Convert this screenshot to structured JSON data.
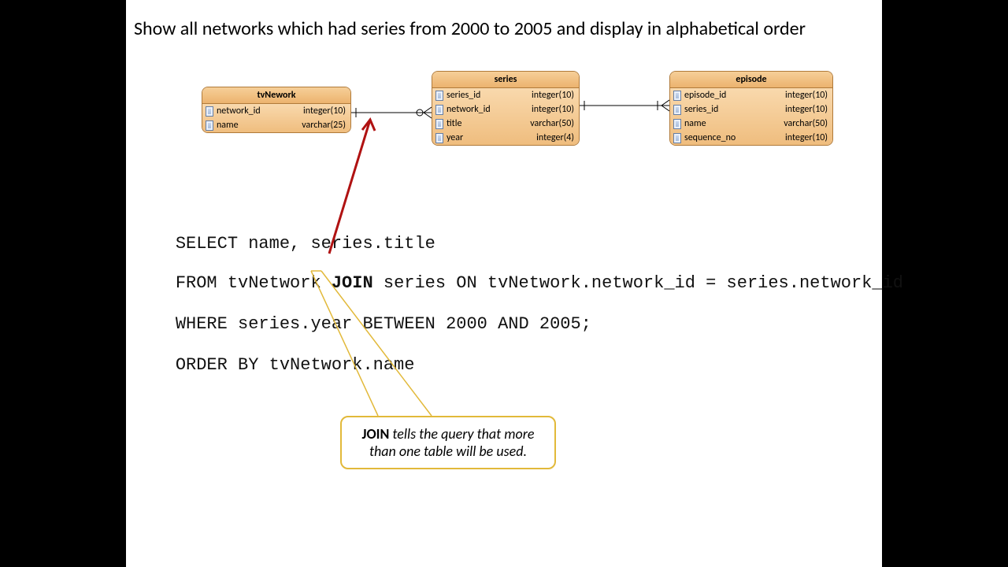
{
  "prompt": "Show all networks which had series from 2000 to 2005 and display in alphabetical order",
  "tables": {
    "tvNework": {
      "title": "tvNework",
      "columns": [
        {
          "name": "network_id",
          "type": "integer(10)"
        },
        {
          "name": "name",
          "type": "varchar(25)"
        }
      ]
    },
    "series": {
      "title": "series",
      "columns": [
        {
          "name": "series_id",
          "type": "integer(10)"
        },
        {
          "name": "network_id",
          "type": "integer(10)"
        },
        {
          "name": "title",
          "type": "varchar(50)"
        },
        {
          "name": "year",
          "type": "integer(4)"
        }
      ]
    },
    "episode": {
      "title": "episode",
      "columns": [
        {
          "name": "episode_id",
          "type": "integer(10)"
        },
        {
          "name": "series_id",
          "type": "integer(10)"
        },
        {
          "name": "name",
          "type": "varchar(50)"
        },
        {
          "name": "sequence_no",
          "type": "integer(10)"
        }
      ]
    }
  },
  "sql": {
    "line1_a": "SELECT name, series.title",
    "line2_a": "FROM tvNetwork ",
    "line2_join": "JOIN",
    "line2_b": " series ON tvNetwork.network_id = series.network_id",
    "line3": "WHERE series.year BETWEEN 2000 AND 2005;",
    "line4": "ORDER BY tvNetwork.name"
  },
  "callout": {
    "join_word": "JOIN",
    "rest_first": " tells the query that more",
    "rest_second": "than one table will be used."
  }
}
